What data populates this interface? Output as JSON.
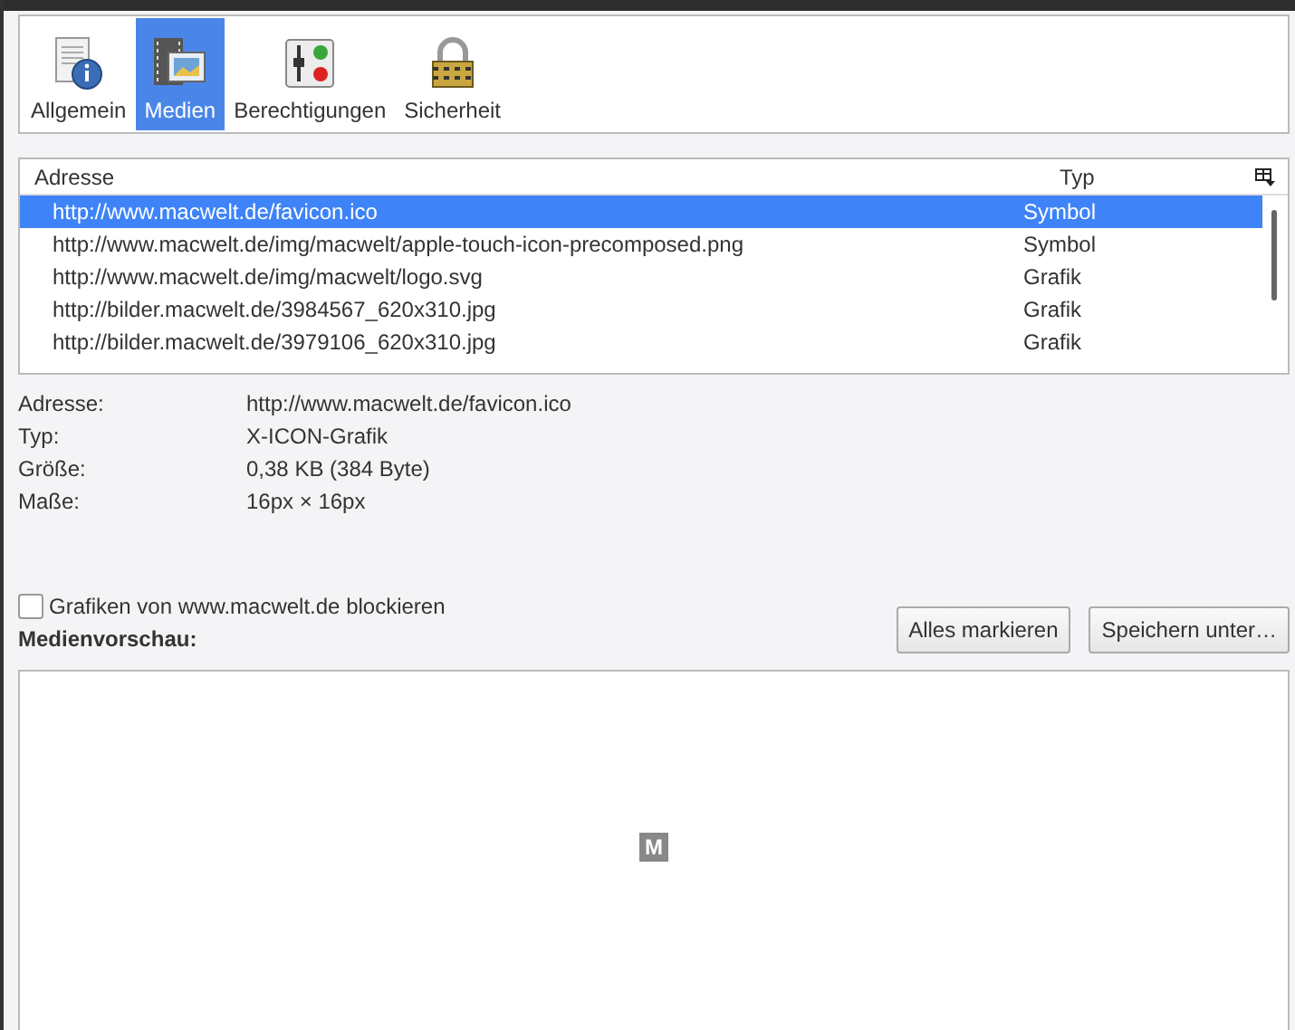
{
  "tabs": [
    {
      "label": "Allgemein",
      "kind": "info",
      "selected": false
    },
    {
      "label": "Medien",
      "kind": "media",
      "selected": true
    },
    {
      "label": "Berechtigungen",
      "kind": "permissions",
      "selected": false
    },
    {
      "label": "Sicherheit",
      "kind": "lock",
      "selected": false
    }
  ],
  "media_list": {
    "columns": [
      "Adresse",
      "Typ"
    ],
    "rows": [
      {
        "address": "http://www.macwelt.de/favicon.ico",
        "type": "Symbol",
        "selected": true
      },
      {
        "address": "http://www.macwelt.de/img/macwelt/apple-touch-icon-precomposed.png",
        "type": "Symbol",
        "selected": false
      },
      {
        "address": "http://www.macwelt.de/img/macwelt/logo.svg",
        "type": "Grafik",
        "selected": false
      },
      {
        "address": "http://bilder.macwelt.de/3984567_620x310.jpg",
        "type": "Grafik",
        "selected": false
      },
      {
        "address": "http://bilder.macwelt.de/3979106_620x310.jpg",
        "type": "Grafik",
        "selected": false
      }
    ]
  },
  "details": [
    {
      "label": "Adresse:",
      "value": "http://www.macwelt.de/favicon.ico"
    },
    {
      "label": "Typ:",
      "value": "X-ICON-Grafik"
    },
    {
      "label": "Größe:",
      "value": "0,38 KB (384 Byte)"
    },
    {
      "label": "Maße:",
      "value": "16px × 16px"
    }
  ],
  "block_checkbox": {
    "label": "Grafiken von www.macwelt.de blockieren",
    "checked": false
  },
  "buttons": [
    "Alles markieren",
    "Speichern unter…"
  ],
  "preview": {
    "label": "Medienvorschau:",
    "image_letter": "M"
  }
}
